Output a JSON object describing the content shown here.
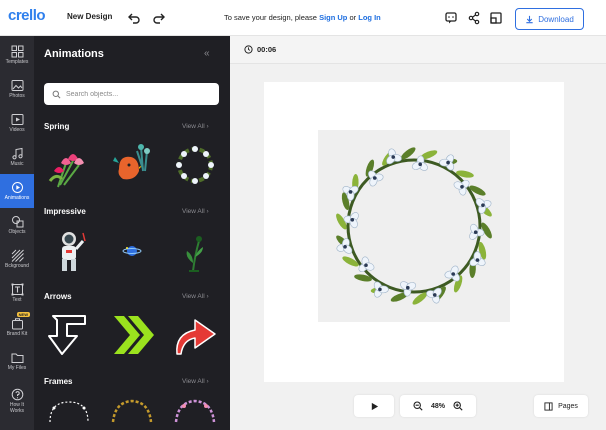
{
  "app": {
    "logo": "crello",
    "design_name": "New Design",
    "save_message": {
      "prefix": "To save your design, please ",
      "signup": "Sign Up",
      "middle": " or ",
      "login": "Log In"
    },
    "download_label": "Download"
  },
  "rail": {
    "items": [
      {
        "label": "Templates",
        "icon": "templates-icon"
      },
      {
        "label": "Photos",
        "icon": "photos-icon"
      },
      {
        "label": "Videos",
        "icon": "videos-icon"
      },
      {
        "label": "Music",
        "icon": "music-icon"
      },
      {
        "label": "Animations",
        "icon": "animations-icon"
      },
      {
        "label": "Objects",
        "icon": "objects-icon"
      },
      {
        "label": "Bckground",
        "icon": "background-icon"
      },
      {
        "label": "Text",
        "icon": "text-icon"
      },
      {
        "label": "Brand Kit",
        "icon": "brand-kit-icon",
        "badge": "NEW"
      },
      {
        "label": "My Files",
        "icon": "my-files-icon"
      },
      {
        "label": "How It Works",
        "icon": "help-icon"
      }
    ]
  },
  "panel": {
    "title": "Animations",
    "search_placeholder": "Search objects...",
    "view_all": "View All",
    "sections": [
      {
        "title": "Spring"
      },
      {
        "title": "Impressive"
      },
      {
        "title": "Arrows"
      },
      {
        "title": "Frames"
      }
    ]
  },
  "canvas": {
    "timer": "00:06",
    "zoom": "48%",
    "pages_label": "Pages"
  },
  "colors": {
    "accent": "#2f6fe0",
    "panel_bg": "#1f1f24",
    "rail_bg": "#2b2b31"
  }
}
